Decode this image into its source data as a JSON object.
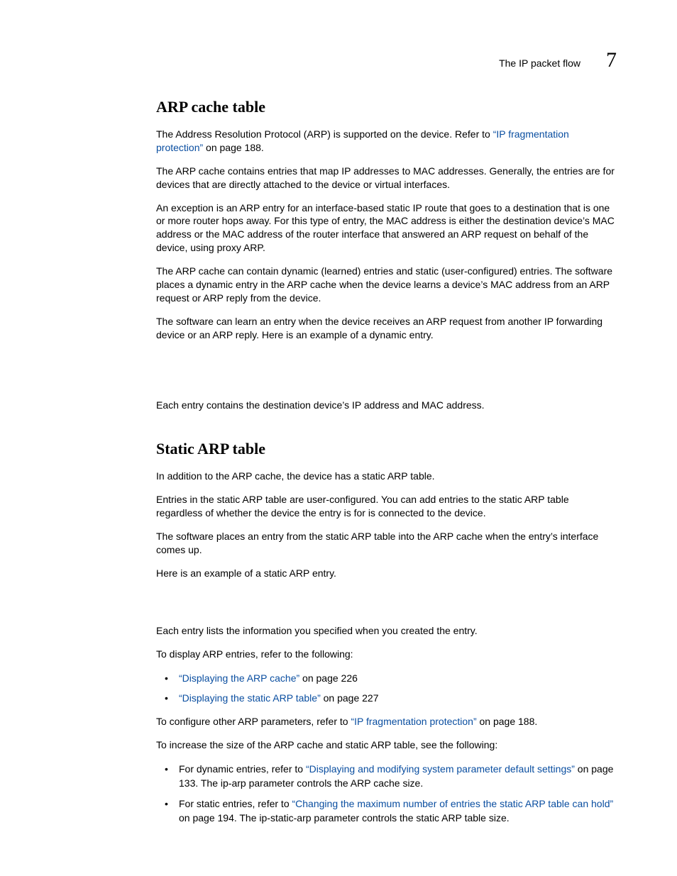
{
  "header": {
    "running_title": "The IP packet flow",
    "chapter_number": "7"
  },
  "sections": {
    "arp_cache": {
      "heading": "ARP cache table",
      "p1_a": "The Address Resolution Protocol (ARP) is supported on the device. Refer to ",
      "p1_link": "“IP fragmentation protection”",
      "p1_b": " on page 188.",
      "p2": "The ARP cache contains entries that map IP addresses to MAC addresses. Generally, the entries are for devices that are directly attached to the device or virtual interfaces.",
      "p3": "An exception is an ARP entry for an interface-based static IP route that goes to a destination that is one or more router hops away. For this type of entry, the MAC address is either the destination device’s MAC address or the MAC address of the router interface that answered an ARP request on behalf of the device, using proxy ARP.",
      "p4": "The ARP cache can contain dynamic (learned) entries and static (user-configured) entries. The software places a dynamic entry in the ARP cache when the device learns a device’s MAC address from an ARP request or ARP reply from the device.",
      "p5": "The software can learn an entry when the device receives an ARP request from another IP forwarding device or an ARP reply. Here is an example of a dynamic entry.",
      "p6": "Each entry contains the destination device’s IP address and MAC address."
    },
    "static_arp": {
      "heading": "Static ARP table",
      "p1": "In addition to the ARP cache, the device has a static ARP table.",
      "p2": "Entries in the static ARP table are user-configured. You can add entries to the static ARP table regardless of whether the device the entry is for is connected to the device.",
      "p3": "The software places an entry from the static ARP table into the ARP cache when the entry’s interface comes up.",
      "p4": "Here is an example of a static ARP entry.",
      "p5": "Each entry lists the information you specified when you created the entry.",
      "p6": "To display ARP entries, refer to the following:",
      "bullets1": {
        "b1_link": "“Displaying the ARP cache”",
        "b1_tail": " on page 226",
        "b2_link": "“Displaying the static ARP table”",
        "b2_tail": " on page 227"
      },
      "p7_a": "To configure other ARP parameters, refer to ",
      "p7_link": "“IP fragmentation protection”",
      "p7_b": " on page 188.",
      "p8": "To increase the size of the ARP cache and static ARP table, see the following:",
      "bullets2": {
        "b1_a": "For dynamic entries, refer to ",
        "b1_link": "“Displaying and modifying system parameter default settings”",
        "b1_b": " on page 133.   The ip-arp parameter controls the ARP cache size.",
        "b2_a": "For static entries, refer to ",
        "b2_link": "“Changing the maximum number of entries the static ARP table can hold”",
        "b2_b": " on page 194. The ip-static-arp parameter controls the static ARP table size."
      }
    }
  }
}
